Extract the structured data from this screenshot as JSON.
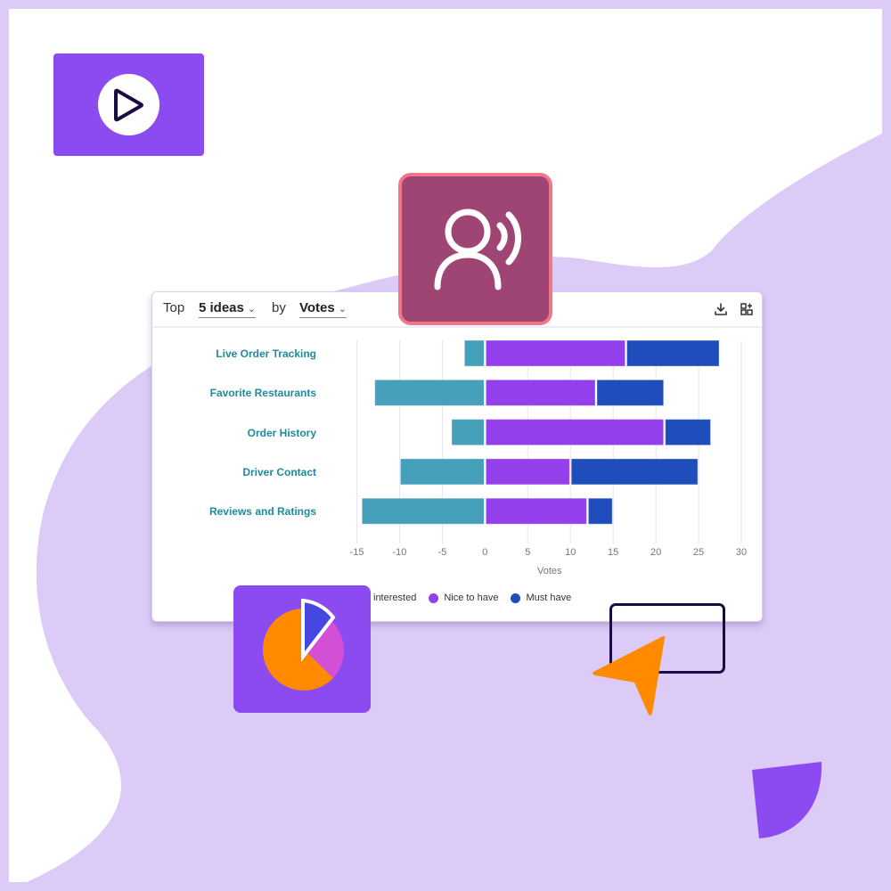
{
  "header": {
    "prefix": "Top",
    "count_select": "5 ideas",
    "joiner": "by",
    "metric_select": "Votes",
    "chevron": "⌄",
    "icons": [
      "download-icon",
      "add-widget-icon"
    ]
  },
  "decor": {
    "icons": [
      "play-video-icon",
      "speaking-user-icon",
      "pie-chart-icon",
      "cursor-arrow-icon",
      "selection-rectangle",
      "quarter-circle-shape"
    ],
    "colors": {
      "background": "#dccbf7",
      "white_panel": "#ffffff",
      "purple_tile": "#8c4bf0",
      "speaker_tile": "#9e4573",
      "speaker_border": "#f0768a",
      "orange": "#ff8a00"
    }
  },
  "chart_data": {
    "type": "bar",
    "orientation": "horizontal-stacked-diverging",
    "categories": [
      "Live Order Tracking",
      "Favorite Restaurants",
      "Order History",
      "Driver Contact",
      "Reviews and Ratings"
    ],
    "series": [
      {
        "name": "interested",
        "color": "#46a0b9",
        "values": [
          -2.5,
          -13,
          -4,
          -10,
          -14.5
        ]
      },
      {
        "name": "Nice to have",
        "color": "#9340ec",
        "values": [
          16.5,
          13,
          21,
          10,
          12
        ]
      },
      {
        "name": "Must have",
        "color": "#1f4ebc",
        "values": [
          11,
          8,
          5.5,
          15,
          3
        ]
      }
    ],
    "xlabel": "Votes",
    "ylabel": "",
    "xlim": [
      -15,
      30
    ],
    "xticks": [
      "-15",
      "-10",
      "-5",
      "0",
      "5",
      "10",
      "15",
      "20",
      "25",
      "30"
    ],
    "grid": true,
    "legend": "bottom"
  }
}
